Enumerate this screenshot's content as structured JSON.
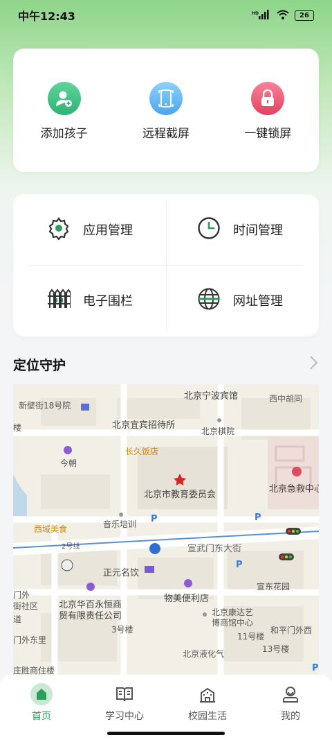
{
  "status_bar": {
    "time": "中午12:43",
    "signal": "HD",
    "battery": "26"
  },
  "quick_actions": [
    {
      "label": "添加孩子",
      "icon": "add-child-icon",
      "color": "#3cbf83"
    },
    {
      "label": "远程截屏",
      "icon": "screenshot-phone-icon",
      "color": "#5fb7f1"
    },
    {
      "label": "一键锁屏",
      "icon": "lock-icon",
      "color": "#ee5573"
    }
  ],
  "tools": [
    {
      "label": "应用管理",
      "icon": "gear-icon"
    },
    {
      "label": "时间管理",
      "icon": "clock-icon"
    },
    {
      "label": "电子围栏",
      "icon": "fence-icon"
    },
    {
      "label": "网址管理",
      "icon": "globe-icon"
    }
  ],
  "location": {
    "title": "定位守护"
  },
  "map": {
    "labels": [
      "新壁街18号院",
      "北京宁波宾馆",
      "西中胡同",
      "北京宜宾招待所",
      "北京棋院",
      "长久饭店",
      "今朝",
      "北京市教育委员会",
      "北京急救中心",
      "西域美食",
      "音乐培训",
      "2号线",
      "宣武门东大街",
      "正元名饮",
      "宣东花园",
      "北京华百永恒商",
      "贸有限责任公司",
      "物美便利店",
      "北京康达艺",
      "博商馆中心",
      "门外东里",
      "3号楼",
      "11号楼",
      "和平门外西",
      "13号楼",
      "北京液化气",
      "庄胜商住楼",
      "门外",
      "街社区",
      "道",
      "楼",
      "P",
      "P",
      "P",
      "P"
    ]
  },
  "tab_bar": {
    "tabs": [
      {
        "label": "首页",
        "icon": "home-icon",
        "active": true
      },
      {
        "label": "学习中心",
        "icon": "book-icon",
        "active": false
      },
      {
        "label": "校园生活",
        "icon": "school-icon",
        "active": false
      },
      {
        "label": "我的",
        "icon": "profile-icon",
        "active": false
      }
    ]
  },
  "colors": {
    "accent": "#2f9e5b",
    "home_badge": "#c9ead2"
  }
}
